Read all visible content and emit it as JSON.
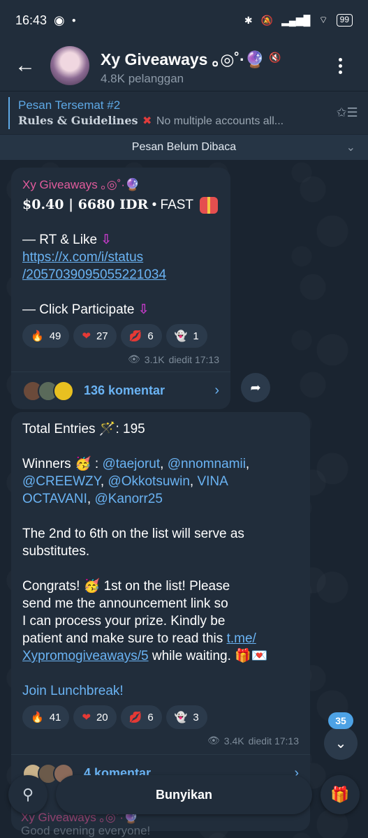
{
  "status_bar": {
    "time": "16:43",
    "battery": "99"
  },
  "header": {
    "title": "Xy Giveaways ｡◎˚·🔮",
    "subtitle": "4.8K pelanggan"
  },
  "pinned": {
    "title": "Pesan Tersemat #2",
    "preview_bold": "Rules & Guidelines",
    "preview_rest": "No multiple accounts all..."
  },
  "unread_bar": {
    "label": "Pesan Belum Dibaca"
  },
  "post1": {
    "author": "Xy Giveaways ｡◎˚·🔮",
    "price": "$0.40 | 6680 IDR",
    "price_suffix": " • FAST",
    "rt_like": "— RT & Like",
    "link_line1": "https://x.com/i/status",
    "link_line2": "/2057039095055221034",
    "click": "— Click Participate",
    "reactions": [
      {
        "icon": "🔥",
        "count": "49"
      },
      {
        "icon": "❤",
        "count": "27"
      },
      {
        "icon": "💋",
        "count": "6"
      },
      {
        "icon": "👻",
        "count": "1"
      }
    ],
    "views": "3.1K",
    "edited": "diedit 17:13",
    "comments": "136 komentar"
  },
  "post2": {
    "entries": "Total Entries 🪄: 195",
    "winners_label": "Winners 🥳 : ",
    "w1": "@taejorut",
    "w2": "@nnomnamii",
    "w3": "@CREEWZY",
    "w4": "@Okkotsuwin",
    "w5": "VINA OCTAVANI",
    "w6": "@Kanorr25",
    "subs1": "The 2nd to 6th on the list will serve as",
    "subs2": "substitutes.",
    "congrats1": "Congrats! 🥳 1st on the list! Please",
    "congrats2": "send me the announcement link so",
    "congrats3": "I can process your prize. Kindly be",
    "congrats4a": "patient and make sure to read this ",
    "congrats4b": "t.me/",
    "congrats5a": "Xypromogiveaways/5",
    "congrats5b": " while waiting. 🎁💌",
    "join": "Join Lunchbreak!",
    "reactions": [
      {
        "icon": "🔥",
        "count": "41"
      },
      {
        "icon": "❤",
        "count": "20"
      },
      {
        "icon": "💋",
        "count": "6"
      },
      {
        "icon": "👻",
        "count": "3"
      }
    ],
    "views": "3.4K",
    "edited": "diedit 17:13",
    "comments": "4 komentar"
  },
  "scroll": {
    "unread_count": "35"
  },
  "bottom": {
    "unmute_label": "Bunyikan"
  },
  "peek": {
    "author": "Xy Giveaways ｡◎˚·🔮",
    "text": "Good evening everyone!"
  }
}
